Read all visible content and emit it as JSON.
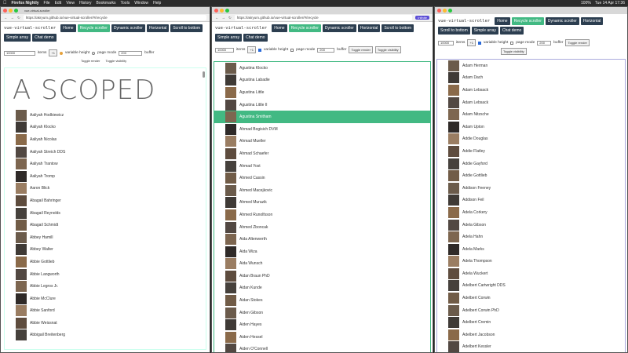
{
  "system": {
    "app_name": "Firefox Nightly",
    "menus": [
      "File",
      "Edit",
      "View",
      "History",
      "Bookmarks",
      "Tools",
      "Window",
      "Help"
    ],
    "clock": "Tue 14 Apr  17:36",
    "battery": "100%"
  },
  "windows": [
    {
      "url": "https://akryum.github.io/vue-virtual-scroller/#/recycle",
      "title": "vue-virtual-scroller",
      "buttons": [
        "Home",
        "Recycle scroller",
        "Dynamic scroller",
        "Horizontal",
        "Scroll to bottom",
        "Simple array",
        "Chat demo"
      ],
      "active_button": "Recycle scroller",
      "count_value": "10000",
      "items_label": "items",
      "plus_label": "+1",
      "variable_height_label": "variable height",
      "page_mode_label": "page mode",
      "buffer_value": "200",
      "buffer_label": "buffer",
      "toggle_render": "Toggle render",
      "toggle_visibility": "Toggle visibility",
      "scoped_text": "A SCOPED",
      "names": [
        "Aaliyah Hodkiewicz",
        "Aaliyah Klocko",
        "Aaliyah Nicolas",
        "Aaliyah Streich DDS",
        "Aaliyah Trantow",
        "Aaliyah Tromp",
        "Aaron Blick",
        "Abagail Bahringer",
        "Abagail Reynolds",
        "Abagail Schmidt",
        "Abbey Hamill",
        "Abbey Walter",
        "Abbie Gottlieb",
        "Abbie Langworth",
        "Abbie Legros Jr.",
        "Abbie McClure",
        "Abbie Sanford",
        "Abbie Weissnat",
        "Abbigail Breitenberg"
      ]
    },
    {
      "url": "https://akryum.github.io/vue-virtual-scroller/#/recycle",
      "infinite_label": "Infinite",
      "title": "vue-virtual-scroller",
      "buttons": [
        "Home",
        "Recycle scroller",
        "Dynamic scroller",
        "Horizontal",
        "Scroll to bottom",
        "Simple array",
        "Chat demo"
      ],
      "count_value": "10000",
      "items_label": "items",
      "plus_label": "+1",
      "variable_height_label": "variable height",
      "page_mode_label": "page mode",
      "buffer_value": "200",
      "buffer_label": "buffer",
      "toggle_render": "Toggle render",
      "toggle_visibility": "Toggle visibility",
      "names": [
        "Agustina Klocko",
        "Agustina Labadie",
        "Agustina Little",
        "Agustina Little II",
        "Agustina Smitham",
        "Ahmad Bogisich DVM",
        "Ahmad Mueller",
        "Ahmad Schaefer",
        "Ahmad Yost",
        "Ahmed Cassin",
        "Ahmed Macejkovic",
        "Ahmed Murazik",
        "Ahmed Runolfsson",
        "Ahmed Zboncak",
        "Aida Altenwerth",
        "Aida Wiza",
        "Aida Wunsch",
        "Aidan Braun PhD",
        "Aidan Kunde",
        "Aidan Stokes",
        "Aiden Gibson",
        "Aiden Hayes",
        "Aiden Hessel",
        "Aiden O'Connell"
      ],
      "selected_index": 4
    },
    {
      "url": "https://akryum.github.io/vue-virtual-scroller/#/recycle",
      "title": "vue-virtual-scroller",
      "buttons": [
        "Home",
        "Recycle scroller",
        "Dynamic scroller",
        "Horizontal",
        "Scroll to bottom",
        "Simple array",
        "Chat demo"
      ],
      "count_value": "10000",
      "items_label": "items",
      "plus_label": "+1",
      "variable_height_label": "variable height",
      "page_mode_label": "page mode",
      "buffer_value": "200",
      "buffer_label": "buffer",
      "toggle_render": "Toggle render",
      "toggle_visibility": "Toggle visibility",
      "names": [
        "Adam Herman",
        "Adam Dach",
        "Adam Lebsack",
        "Adam Lebsack",
        "Adam Nitzsche",
        "Adam Upton",
        "Addie Douglas",
        "Addie Flatley",
        "Addie Gayford",
        "Addie Gottlieb",
        "Addison Feeney",
        "Addison Feil",
        "Adela Corkery",
        "Adela Gibson",
        "Adela Hahn",
        "Adela Marks",
        "Adela Thompson",
        "Adela Wuckert",
        "Adelbert Cartwright DDS",
        "Adelbert Corwin",
        "Adelbert Corwin PhD",
        "Adelbert Cremin",
        "Adelbert Jacobson",
        "Adelbert Kessler"
      ]
    }
  ],
  "colors": {
    "accent": "#42b983",
    "button": "#2c3e50"
  }
}
